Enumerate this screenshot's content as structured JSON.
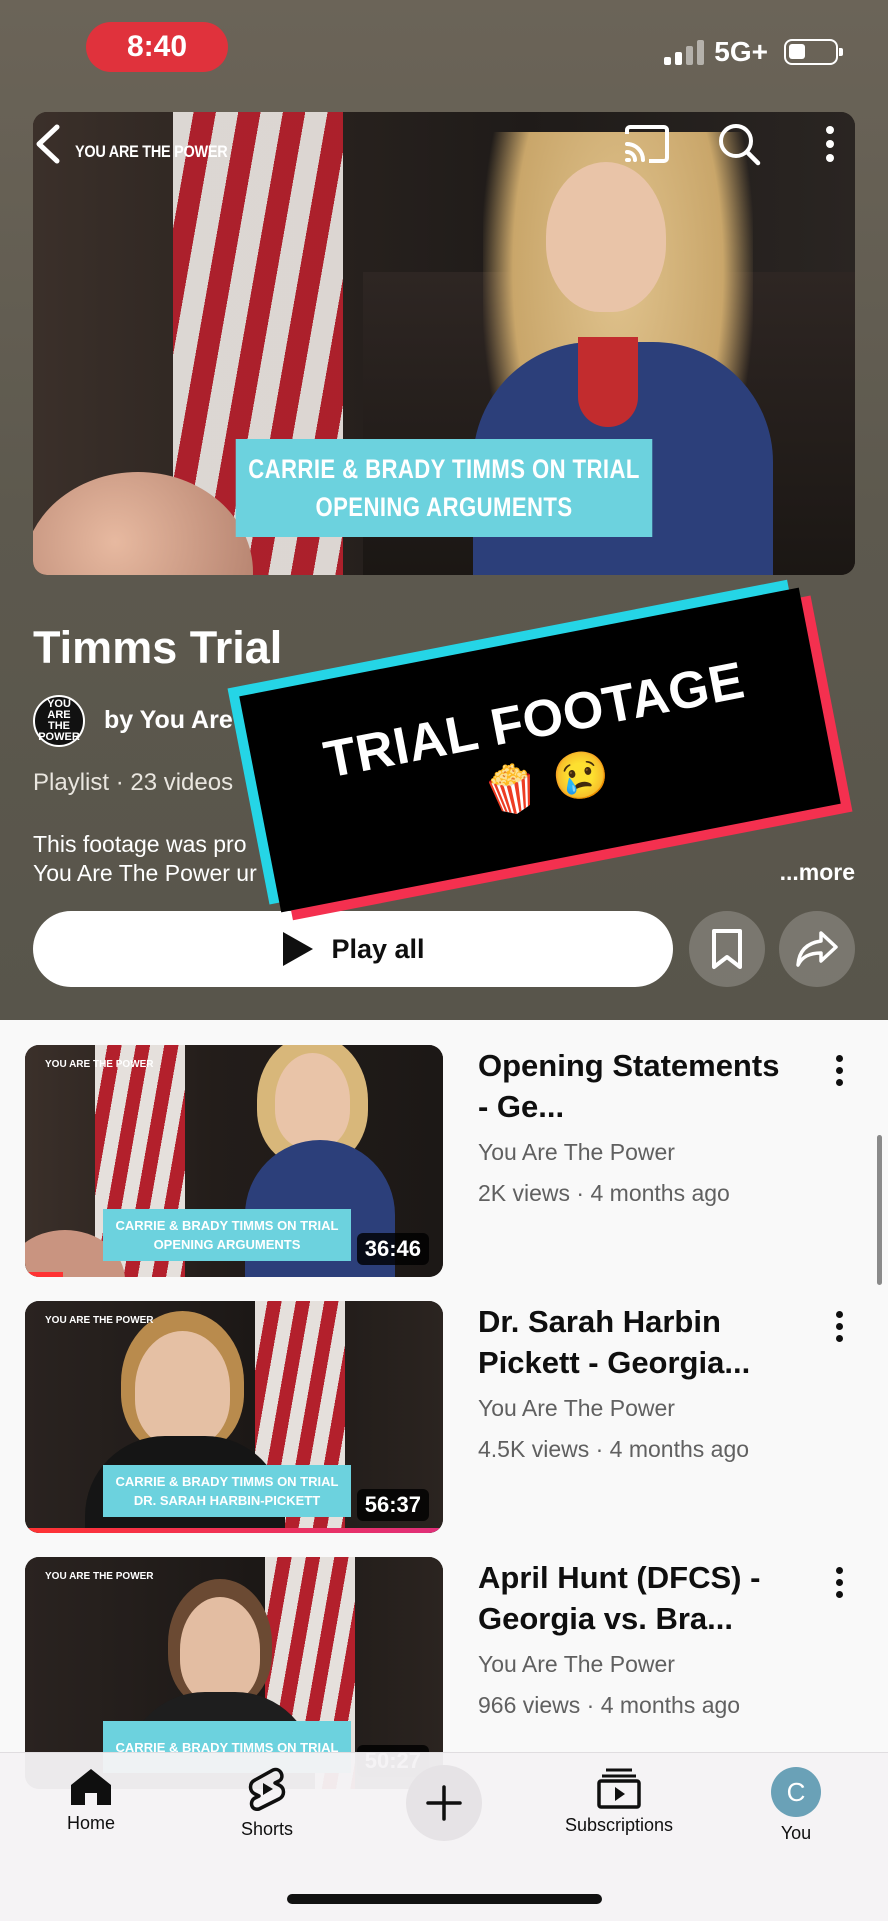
{
  "status_bar": {
    "time": "8:40",
    "network": "5G+"
  },
  "hero": {
    "channel_logo": "YOU ARE THE POWER",
    "caption_line1": "CARRIE & BRADY TIMMS ON TRIAL",
    "caption_line2": "OPENING ARGUMENTS",
    "icons": [
      "back-icon",
      "cast-icon",
      "search-icon",
      "more-vert-icon"
    ]
  },
  "playlist": {
    "title": "Timms Trial",
    "avatar_text": "YOU ARE THE POWER",
    "by": "by You Are T",
    "meta": "Playlist · 23 videos",
    "description_line1": "This footage was pro",
    "description_line2": "You Are The Power ur",
    "more": "...more",
    "play_all": "Play all"
  },
  "sticker": {
    "text": "TRIAL FOOTAGE",
    "emoji": "🍿 😢"
  },
  "videos": [
    {
      "title": "Opening Statements - Ge...",
      "channel": "You Are The Power",
      "stats": "2K views · 4 months ago",
      "duration": "36:46",
      "caption_line1": "CARRIE & BRADY TIMMS ON TRIAL",
      "caption_line2": "OPENING ARGUMENTS",
      "logo": "YOU ARE THE POWER",
      "progress": 0.09
    },
    {
      "title": "Dr. Sarah Harbin Pickett - Georgia...",
      "channel": "You Are The Power",
      "stats": "4.5K views · 4 months ago",
      "duration": "56:37",
      "caption_line1": "CARRIE & BRADY TIMMS ON TRIAL",
      "caption_line2": "DR. SARAH HARBIN-PICKETT",
      "logo": "YOU ARE THE POWER",
      "progress": 1.0
    },
    {
      "title": "April Hunt (DFCS) - Georgia vs. Bra...",
      "channel": "You Are The Power",
      "stats": "966 views · 4 months ago",
      "duration": "50:27",
      "caption_line1": "CARRIE & BRADY TIMMS ON TRIAL",
      "caption_line2": "",
      "logo": "YOU ARE THE POWER",
      "progress": 0
    }
  ],
  "nav": {
    "home": "Home",
    "shorts": "Shorts",
    "subscriptions": "Subscriptions",
    "you": "You",
    "you_initial": "C"
  },
  "colors": {
    "accent_red": "#f33",
    "caption_teal": "#6cd2de",
    "tiktok_cyan": "#25d5e6",
    "tiktok_pink": "#f4304f"
  }
}
